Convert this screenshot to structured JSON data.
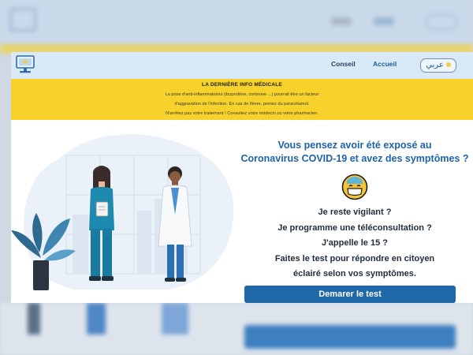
{
  "nav": {
    "conseil": "Conseil",
    "accueil": "Accueil",
    "language": "عربي"
  },
  "banner": {
    "title": "LA DERNIÈRE INFO MÉDICALE",
    "line1": "La prise d'anti-inflammatoires (ibuprofène, cortisone ...) pourrait être un facteur",
    "line2": "d'aggravation de l'infection. En cas de fièvre, prenez du paracétamol.",
    "line3": "N'arrêtez pas votre traitement ! Consultez votre médecin ou votre pharmacien."
  },
  "main": {
    "headline_line1": "Vous pensez avoir été exposé au",
    "headline_line2": "Coronavirus COVID-19 et avez des symptômes ?",
    "q1": "Je reste vigilant ?",
    "q2": "Je programme une téléconsultation ?",
    "q3": "J'appelle le 15 ?",
    "q4": "Faites le test pour répondre en citoyen",
    "q5": "éclairé selon vos symptômes.",
    "cta": "Demarer le test"
  },
  "colors": {
    "header_bg": "#d9e9f6",
    "banner_bg": "#f6d22b",
    "accent_blue": "#1e63a8",
    "button_bg": "#1f69a8"
  },
  "icons": {
    "logo": "monitor-logo-icon",
    "emoji": "sick-face-emoji-icon"
  }
}
